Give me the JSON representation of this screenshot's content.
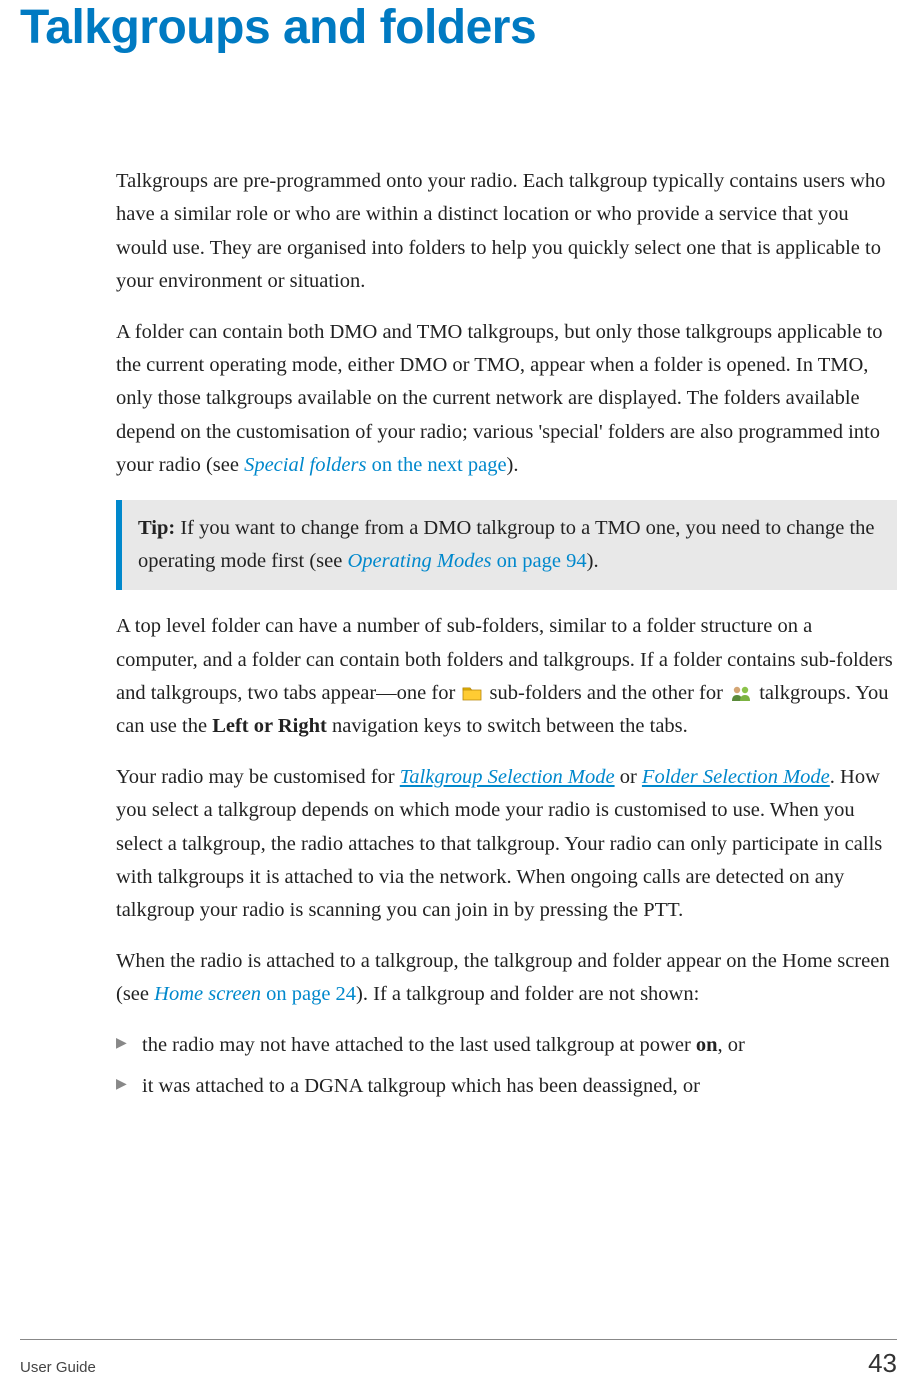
{
  "title": "Talkgroups and folders",
  "para1": "Talkgroups are pre-programmed onto your radio. Each talkgroup typically contains users who have a similar role or who are within a distinct location or who provide a service that you would use. They are organised into folders to help you quickly select one that is applicable to your environment or situation.",
  "para2_a": "A folder can contain both DMO and TMO talkgroups, but only those talkgroups applicable to the current operating mode, either DMO or TMO, appear when a folder is opened. In TMO, only those talkgroups available on the current network are displayed. The folders available depend on the customisation of your radio; various 'special' folders are also programmed into your radio (see ",
  "para2_link_italic": "Special folders",
  "para2_link_plain": " on the next page",
  "para2_tail": ").",
  "tip_label": "Tip:",
  "tip_body_a": "  If you want to change from a DMO talkgroup to a TMO one, you need to change the operating mode first (see ",
  "tip_link_italic": "Operating Modes",
  "tip_link_plain": " on page 94",
  "tip_tail": ").",
  "para3_a": "A top level folder can have a number of sub-folders, similar to a folder structure on a computer, and a folder can contain both folders and talkgroups. If a folder contains sub-folders and talkgroups, two tabs appear—one for ",
  "para3_mid1": " sub-folders and the other for ",
  "para3_mid2": " talkgroups. You can use the ",
  "para3_bold": "Left or Right",
  "para3_tail": " navigation keys to switch between the tabs.",
  "para4_a": "Your radio may be customised for ",
  "para4_link1": "Talkgroup Selection Mode",
  "para4_b": " or ",
  "para4_link2": "Folder Selection Mode",
  "para4_c": ". How you select a talkgroup depends on which mode your radio is customised to use. When you select a talkgroup, the radio attaches to that talkgroup. Your radio can only participate in calls with talkgroups it is attached to via the network. When ongoing calls are detected on any talkgroup your radio is scanning you can join in by pressing the PTT.",
  "para5_a": "When the radio is attached to a talkgroup, the talkgroup and folder appear on the Home screen (see ",
  "para5_link_italic": "Home screen",
  "para5_link_plain": " on page 24",
  "para5_b": "). If a talkgroup and folder are not shown:",
  "bullet1_a": "the radio may not have attached to the last used talkgroup at power ",
  "bullet1_bold": "on",
  "bullet1_b": ", or",
  "bullet2": "it was attached to a DGNA talkgroup which has been deassigned, or",
  "footer_left": "User Guide",
  "footer_right": "43"
}
